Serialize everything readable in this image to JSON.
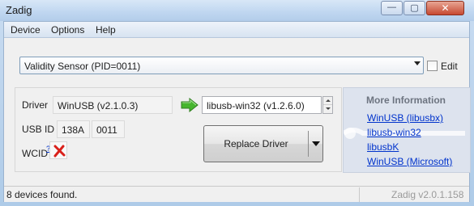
{
  "window": {
    "title": "Zadig",
    "minimize_glyph": "—",
    "maximize_glyph": "▢",
    "close_glyph": "✕"
  },
  "menu": {
    "items": [
      {
        "label": "Device"
      },
      {
        "label": "Options"
      },
      {
        "label": "Help"
      }
    ]
  },
  "device": {
    "selected": "Validity Sensor (PID=0011)",
    "edit_label": "Edit",
    "edit_checked": false
  },
  "driver": {
    "driver_label": "Driver",
    "current_driver": "WinUSB (v2.1.0.3)",
    "target_driver": "libusb-win32 (v1.2.6.0)",
    "usb_id_label": "USB ID",
    "vid": "138A",
    "pid": "0011",
    "wcid_label": "WCID",
    "wcid_help": "?",
    "wcid_status_icon": "red-x-icon",
    "replace_button_label": "Replace Driver",
    "arrow_color": "#3fae2a"
  },
  "info": {
    "title": "More Information",
    "links": [
      {
        "label": "WinUSB (libusbx)"
      },
      {
        "label": "libusb-win32"
      },
      {
        "label": "libusbK"
      },
      {
        "label": "WinUSB (Microsoft)"
      }
    ]
  },
  "status": {
    "message": "8 devices found.",
    "version": "Zadig v2.0.1.158"
  }
}
